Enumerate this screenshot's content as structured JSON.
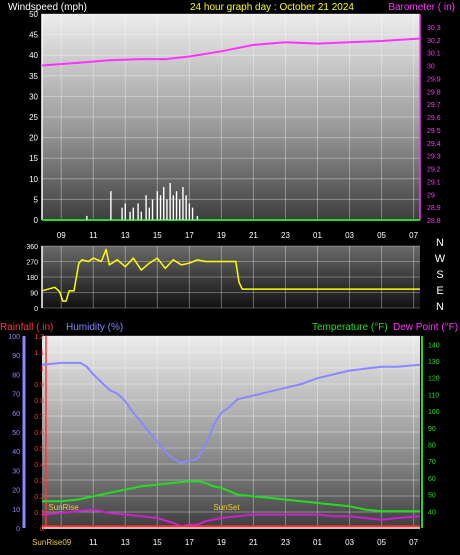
{
  "header": {
    "left": "Windspeed (mph)",
    "center": "24 hour graph day : October 21 2024",
    "right": "Barometer ( in)"
  },
  "colors": {
    "wind": "#ffffff",
    "barometer": "#ff33ff",
    "direction": "#ffff00",
    "rain": "#ff3333",
    "humidity": "#8888ff",
    "temperature": "#22dd22",
    "dewpoint": "#cc22cc",
    "sun": "#eecc33",
    "text": "#ffffff"
  },
  "x_ticks": [
    "09",
    "11",
    "13",
    "15",
    "17",
    "19",
    "21",
    "23",
    "01",
    "03",
    "05",
    "07"
  ],
  "chart_data": [
    {
      "type": "line",
      "name": "top",
      "x_range_hours": [
        7.8,
        31.4
      ],
      "left_axis": {
        "label": "Windspeed (mph)",
        "ylim": [
          0,
          50
        ],
        "ticks": [
          0,
          5,
          10,
          15,
          20,
          25,
          30,
          35,
          40,
          45,
          50
        ]
      },
      "right_axis": {
        "label": "Barometer ( in)",
        "ylim": [
          28.8,
          30.4
        ],
        "ticks": [
          "28.8",
          "28.9",
          "29",
          "29.1",
          "29.2",
          "29.3",
          "29.4",
          "29.5",
          "29.6",
          "29.7",
          "29.8",
          "29.9",
          "30",
          "30.1",
          "30.2",
          "30.3"
        ]
      },
      "series": [
        {
          "name": "Barometer",
          "axis": "right",
          "x": [
            7.8,
            10,
            12,
            14,
            15.5,
            17,
            19,
            21,
            23,
            25,
            27,
            29,
            31.4
          ],
          "y": [
            30.0,
            30.02,
            30.04,
            30.05,
            30.05,
            30.07,
            30.11,
            30.16,
            30.18,
            30.17,
            30.18,
            30.19,
            30.21
          ]
        },
        {
          "name": "Windspeed",
          "axis": "left",
          "style": "gusts",
          "x": [
            10.6,
            12.1,
            12.8,
            13.0,
            13.3,
            13.5,
            13.8,
            14.0,
            14.3,
            14.5,
            14.7,
            15.0,
            15.2,
            15.4,
            15.6,
            15.8,
            16.0,
            16.2,
            16.4,
            16.6,
            16.8,
            17.0,
            17.2,
            17.5
          ],
          "y": [
            1,
            7,
            3,
            4,
            2,
            3,
            4,
            2,
            6,
            3,
            5,
            7,
            6,
            8,
            5,
            9,
            6,
            7,
            5,
            8,
            6,
            4,
            3,
            1
          ]
        }
      ]
    },
    {
      "type": "line",
      "name": "wind direction",
      "x_range_hours": [
        7.8,
        31.4
      ],
      "left_axis": {
        "ylim": [
          0,
          360
        ],
        "ticks": [
          0,
          90,
          180,
          270,
          360
        ]
      },
      "right_labels": [
        "N",
        "W",
        "S",
        "E",
        "N"
      ],
      "series": [
        {
          "name": "Direction",
          "x": [
            7.8,
            8.6,
            8.9,
            9.1,
            9.3,
            9.5,
            9.8,
            10.1,
            10.3,
            10.7,
            11.0,
            11.5,
            11.8,
            12.0,
            12.5,
            13.0,
            13.5,
            14.0,
            14.5,
            15.0,
            15.5,
            16.0,
            16.5,
            17.0,
            17.5,
            18.0,
            19.9,
            20.1,
            20.3,
            31.4
          ],
          "y": [
            100,
            120,
            95,
            40,
            40,
            100,
            100,
            260,
            280,
            270,
            290,
            270,
            340,
            250,
            280,
            240,
            290,
            220,
            260,
            290,
            230,
            280,
            250,
            260,
            280,
            270,
            270,
            150,
            110,
            110
          ]
        }
      ]
    },
    {
      "type": "line",
      "name": "bottom",
      "x_range_hours": [
        7.8,
        31.4
      ],
      "axes": {
        "rainfall": {
          "label": "Rainfall ( in)",
          "ylim": [
            0,
            1.2
          ],
          "ticks": [
            "0",
            "0.1",
            "0.2",
            "0.3",
            "0.4",
            "0.5",
            "0.6",
            "0.7",
            "0.8",
            "0.9",
            "1",
            "1.1",
            "1.2"
          ]
        },
        "humidity": {
          "label": "Humidity (%)",
          "ylim": [
            0,
            100
          ],
          "ticks": [
            0,
            10,
            20,
            30,
            40,
            50,
            60,
            70,
            80,
            90,
            100
          ]
        },
        "temperature": {
          "label": "Temperature (°F)",
          "ylim": [
            30,
            145
          ],
          "ticks": [
            40,
            50,
            60,
            70,
            80,
            90,
            100,
            110,
            120,
            130,
            140
          ]
        },
        "dewpoint": {
          "label": "Dew Point (°F)"
        }
      },
      "series": [
        {
          "name": "Rainfall",
          "axis": "rainfall",
          "x": [
            7.8,
            31.4
          ],
          "y": [
            0.01,
            0.01
          ]
        },
        {
          "name": "Humidity",
          "axis": "humidity",
          "x": [
            7.8,
            9,
            10.2,
            10.6,
            11,
            11.5,
            12,
            12.5,
            13,
            13.5,
            14,
            14.5,
            15,
            15.5,
            16,
            16.5,
            17,
            17.5,
            17.8,
            18.2,
            18.6,
            19,
            19.5,
            20,
            21,
            22,
            23,
            24,
            25,
            26,
            27,
            28,
            29,
            30,
            31.4
          ],
          "y": [
            85,
            86,
            86,
            84,
            80,
            76,
            72,
            70,
            66,
            60,
            55,
            50,
            45,
            40,
            36,
            34,
            35,
            36,
            40,
            47,
            55,
            60,
            63,
            67,
            69,
            71,
            73,
            75,
            78,
            80,
            82,
            83,
            84,
            84,
            85
          ]
        },
        {
          "name": "Temperature",
          "axis": "temperature",
          "x": [
            7.8,
            9,
            10,
            11,
            12,
            13,
            14,
            15,
            16,
            17,
            17.5,
            18,
            18.5,
            19,
            20,
            21,
            22,
            23,
            24,
            25,
            26,
            27,
            28,
            29,
            30,
            31.4
          ],
          "y": [
            46,
            46,
            47,
            49,
            51,
            53,
            55,
            56,
            57,
            58,
            58,
            57,
            55,
            54,
            50,
            49,
            48,
            47,
            46,
            45,
            44,
            43,
            41,
            40,
            40,
            40
          ]
        },
        {
          "name": "Dew Point",
          "axis": "temperature",
          "x": [
            7.8,
            9,
            10,
            11,
            11.5,
            12,
            13,
            14,
            15,
            16,
            16.5,
            17,
            17.5,
            18,
            19,
            20,
            21,
            22,
            23,
            24,
            25,
            26,
            27,
            28,
            29,
            30,
            31.4
          ],
          "y": [
            38,
            39,
            40,
            41,
            40,
            39,
            38,
            37,
            36,
            33,
            31,
            32,
            32,
            34,
            36,
            37,
            38,
            38,
            38,
            38,
            38,
            37,
            37,
            36,
            35,
            36,
            37
          ]
        }
      ],
      "annotations": [
        {
          "text": "SunRise",
          "x_hour": 8.2,
          "where": "lower"
        },
        {
          "text": "SunSet",
          "x_hour": 18.5,
          "where": "lower"
        }
      ],
      "x_label_prefix": "SunRise"
    }
  ]
}
